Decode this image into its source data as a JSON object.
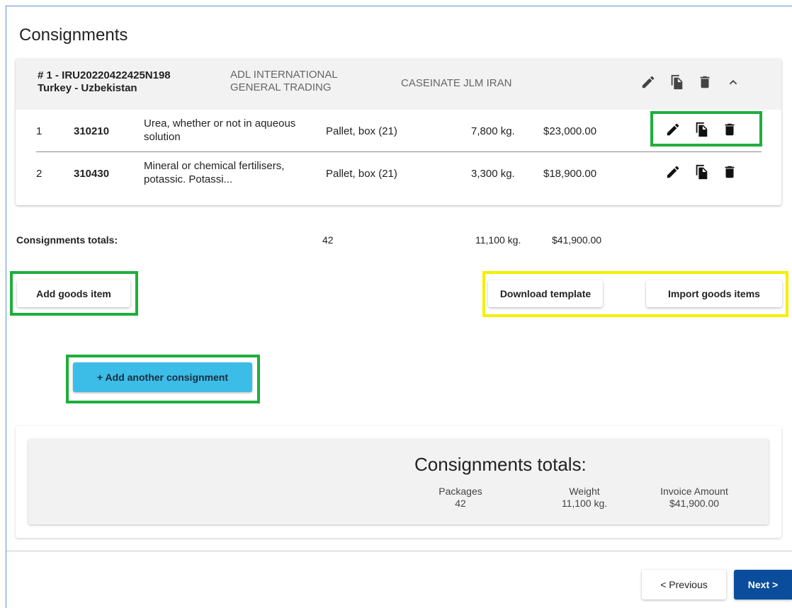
{
  "page": {
    "title": "Consignments"
  },
  "consignment": {
    "id": "# 1 - IRU20220422425N198",
    "route": "Turkey - Uzbekistan",
    "sender": "ADL INTERNATIONAL GENERAL TRADING",
    "consignee": "CASEINATE JLM IRAN",
    "actions": [
      "edit-icon",
      "copy-icon",
      "delete-icon",
      "chevron-up-icon"
    ]
  },
  "goods_items": [
    {
      "num": "1",
      "code": "310210",
      "description": "Urea, whether or not in aqueous solution",
      "packages": "Pallet, box (21)",
      "weight": "7,800 kg.",
      "amount": "$23,000.00"
    },
    {
      "num": "2",
      "code": "310430",
      "description": "Mineral or chemical fertilisers, potassic. Potassi...",
      "packages": "Pallet, box (21)",
      "weight": "3,300 kg.",
      "amount": "$18,900.00"
    }
  ],
  "totals": {
    "label": "Consignments totals:",
    "packages": "42",
    "weight": "11,100 kg.",
    "amount": "$41,900.00"
  },
  "buttons": {
    "add_goods": "Add goods item",
    "download_template": "Download template",
    "import_goods": "Import goods items",
    "add_consignment": "+ Add another consignment",
    "previous": "< Previous",
    "next": "Next >"
  },
  "summary": {
    "title": "Consignments totals:",
    "packages_label": "Packages",
    "packages_value": "42",
    "weight_label": "Weight",
    "weight_value": "11,100 kg.",
    "amount_label": "Invoice Amount",
    "amount_value": "$41,900.00"
  },
  "colors": {
    "highlight_green": "#1fae3c",
    "highlight_yellow": "#f4f000",
    "primary_button": "#3bbde8",
    "next_button": "#0a4d9c"
  }
}
